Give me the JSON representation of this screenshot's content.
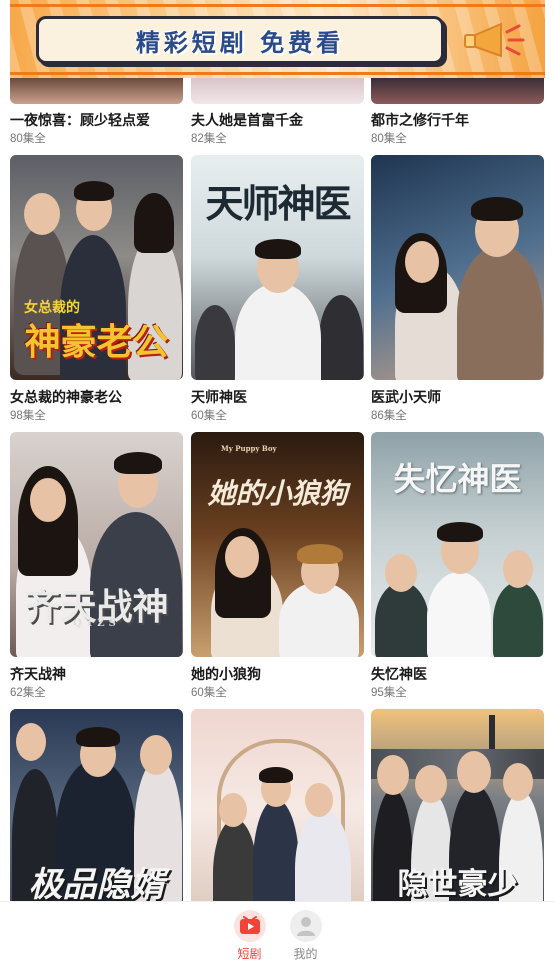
{
  "banner": {
    "text": "精彩短剧 免费看"
  },
  "colors": {
    "accent": "#f0443a",
    "banner_orange": "#f07a1a",
    "banner_text": "#2a4a8a"
  },
  "rows": [
    {
      "cards": [
        {
          "title": "一夜惊喜：顾少轻点爱",
          "episodes": "80集全"
        },
        {
          "title": "夫人她是首富千金",
          "episodes": "82集全"
        },
        {
          "title": "都市之修行千年",
          "episodes": "80集全"
        }
      ]
    },
    {
      "cards": [
        {
          "title": "女总裁的神豪老公",
          "episodes": "98集全",
          "poster_text": "神豪老公",
          "poster_sub": "女总裁的"
        },
        {
          "title": "天师神医",
          "episodes": "60集全",
          "poster_text": "天师神医"
        },
        {
          "title": "医武小天师",
          "episodes": "86集全"
        }
      ]
    },
    {
      "cards": [
        {
          "title": "齐天战神",
          "episodes": "62集全",
          "poster_text": "齐天战神",
          "poster_sub": "QTZS"
        },
        {
          "title": "她的小狼狗",
          "episodes": "60集全",
          "poster_text": "她的小狼狗",
          "poster_sub": "My Puppy Boy"
        },
        {
          "title": "失忆神医",
          "episodes": "95集全",
          "poster_text": "失忆神医"
        }
      ]
    },
    {
      "cards": [
        {
          "title": "",
          "episodes": "",
          "poster_text": "极品隐婿"
        },
        {
          "title": "",
          "episodes": ""
        },
        {
          "title": "",
          "episodes": "",
          "poster_text": "隐世豪少"
        }
      ]
    }
  ],
  "nav": [
    {
      "label": "短剧",
      "icon": "play-video-icon",
      "active": true
    },
    {
      "label": "我的",
      "icon": "user-profile-icon",
      "active": false
    }
  ]
}
